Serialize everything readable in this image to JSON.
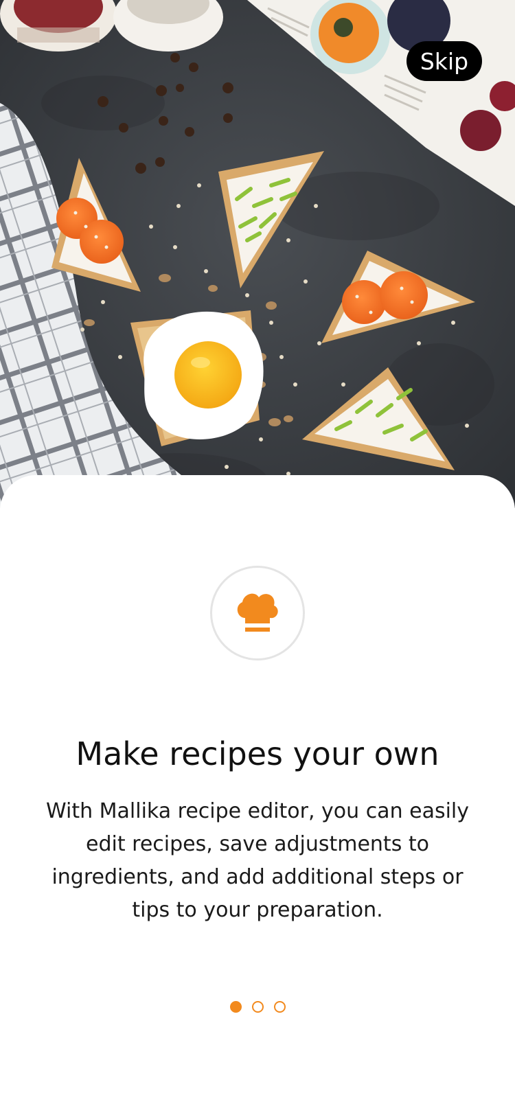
{
  "hero": {
    "image": "flat-lay of toast triangles with cream cheese, carrots, chives and a fried egg on dark stone"
  },
  "skip_button": {
    "label": "Skip"
  },
  "feature": {
    "icon": "chef-hat-icon",
    "title": "Make recipes your own",
    "description": "With Mallika recipe editor, you can easily edit recipes, save adjustments to ingredients, and add additional steps or tips to your preparation."
  },
  "pager": {
    "total": 3,
    "current": 1
  },
  "colors": {
    "accent": "#f28a1e",
    "skip_bg": "#000000",
    "text": "#111111",
    "badge_border": "#e4e4e4"
  }
}
